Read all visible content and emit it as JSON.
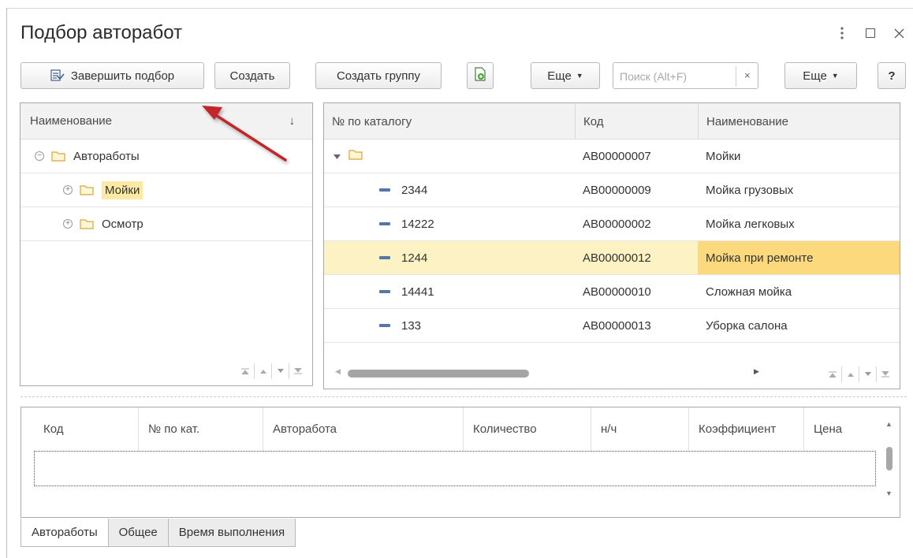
{
  "window": {
    "title": "Подбор авторабот"
  },
  "toolbar": {
    "finish_label": "Завершить подбор",
    "create_label": "Создать",
    "create_group_label": "Создать группу",
    "more_label_1": "Еще",
    "search_placeholder": "Поиск (Alt+F)",
    "search_clear": "×",
    "more_label_2": "Еще",
    "help_label": "?"
  },
  "tree": {
    "header": "Наименование",
    "sort_icon": "↓",
    "items": [
      {
        "label": "Автоработы",
        "expander": "−",
        "level": 0
      },
      {
        "label": "Мойки",
        "expander": "+",
        "level": 1,
        "highlighted": true
      },
      {
        "label": "Осмотр",
        "expander": "+",
        "level": 1
      }
    ]
  },
  "list": {
    "columns": [
      "№ по каталогу",
      "Код",
      "Наименование"
    ],
    "rows": [
      {
        "catalog": "",
        "code": "AB00000007",
        "name": "Мойки",
        "type": "folder"
      },
      {
        "catalog": "2344",
        "code": "AB00000009",
        "name": "Мойка грузовых",
        "type": "item"
      },
      {
        "catalog": "14222",
        "code": "AB00000002",
        "name": "Мойка легковых",
        "type": "item"
      },
      {
        "catalog": "1244",
        "code": "AB00000012",
        "name": "Мойка при ремонте",
        "type": "item",
        "selected": true
      },
      {
        "catalog": "14441",
        "code": "AB00000010",
        "name": "Сложная мойка",
        "type": "item"
      },
      {
        "catalog": "133",
        "code": "AB00000013",
        "name": "Уборка салона",
        "type": "item"
      }
    ]
  },
  "bottom_table": {
    "columns": [
      "Код",
      "№ по кат.",
      "Авторабота",
      "Количество",
      "н/ч",
      "Коэффициент",
      "Цена"
    ]
  },
  "tabs": [
    "Авторабо­ты",
    "Общее",
    "Время выполнения"
  ],
  "colors": {
    "selection": "#fdf2c4",
    "selection_strong": "#fbd97c",
    "folder": "#f2c94c",
    "annotation_arrow": "#c0282a"
  }
}
